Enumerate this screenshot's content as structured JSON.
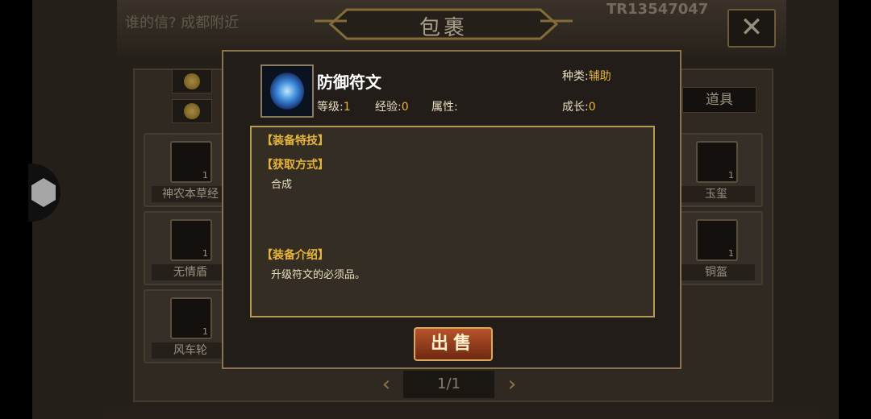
{
  "window": {
    "title": "包裹",
    "player_id": "TR13547047",
    "ticker": "谁的信? 成都附近"
  },
  "tabs": {
    "active": "道具"
  },
  "inventory": [
    {
      "name": "神农本草经",
      "count": "1",
      "icon": "book-icon"
    },
    {
      "name": "无情盾",
      "count": "1",
      "icon": "shield-icon"
    },
    {
      "name": "风车轮",
      "count": "1",
      "icon": "wheel-icon"
    },
    {
      "name": "玉玺",
      "count": "1",
      "icon": "seal-icon"
    },
    {
      "name": "铜盔",
      "count": "1",
      "icon": "helmet-icon"
    }
  ],
  "pager": {
    "text": "1/1"
  },
  "detail": {
    "name": "防御符文",
    "level_label": "等级:",
    "level": "1",
    "exp_label": "经验:",
    "exp": "0",
    "attr_label": "属性:",
    "type_label": "种类:",
    "type": "辅助",
    "growth_label": "成长:",
    "growth": "0",
    "sec_skill": "【装备特技】",
    "sec_source": "【获取方式】",
    "source": "合成",
    "sec_desc": "【装备介绍】",
    "desc": "升级符文的必须品。",
    "sell_label": "出售"
  },
  "colors": {
    "accent": "#e6b53a",
    "frame": "#b49a52",
    "sell_button": "#9a3e1c"
  }
}
